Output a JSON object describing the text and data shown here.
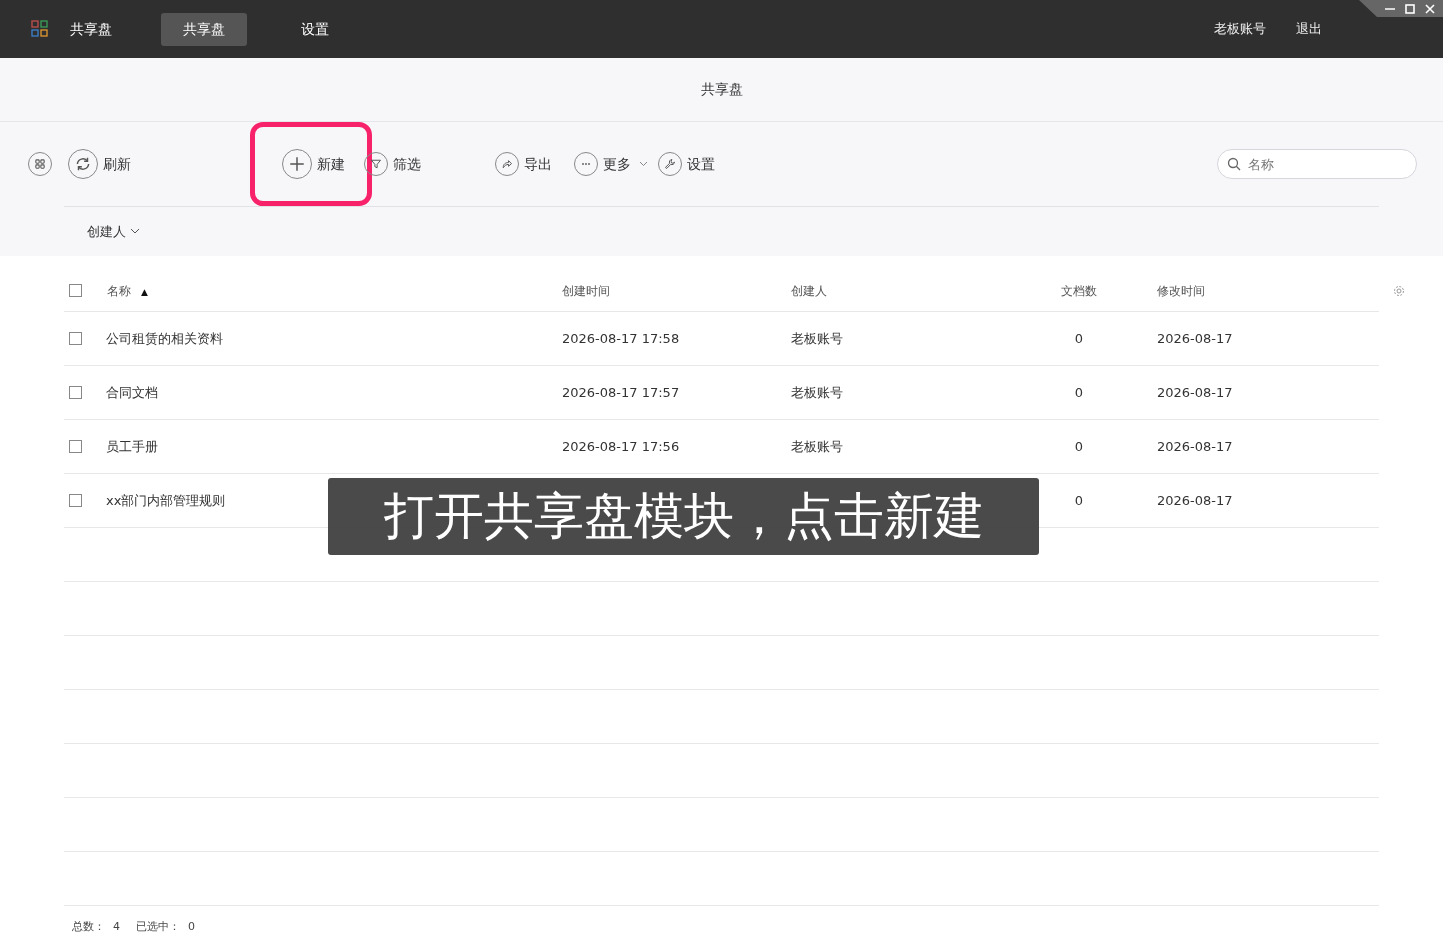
{
  "app": {
    "name": "共享盘"
  },
  "nav_tabs": [
    {
      "label": "共享盘",
      "selected": true
    },
    {
      "label": "设置",
      "selected": false
    }
  ],
  "user_menu": [
    "老板账号",
    "退出"
  ],
  "page_title": "共享盘",
  "toolbar": [
    {
      "kind": "refresh",
      "label": "刷新",
      "highlighted": false
    },
    {
      "kind": "new",
      "label": "新建",
      "highlighted": true
    },
    {
      "kind": "filter",
      "label": "筛选",
      "highlighted": false
    },
    {
      "kind": "export",
      "label": "导出",
      "highlighted": false
    },
    {
      "kind": "more",
      "label": "更多",
      "highlighted": false
    },
    {
      "kind": "settings",
      "label": "设置",
      "highlighted": false
    }
  ],
  "search": {
    "placeholder": "名称"
  },
  "filters": [
    {
      "label": "创建人"
    }
  ],
  "table": {
    "select_all": {
      "checked": false
    },
    "columns": [
      {
        "label": "名称",
        "sort_icon": "▲"
      },
      {
        "label": "创建时间"
      },
      {
        "label": "创建人"
      },
      {
        "label": "文档数"
      },
      {
        "label": "修改时间"
      }
    ],
    "rows": [
      {
        "checked": false,
        "name": "公司租赁的相关资料",
        "created": "2026-08-17 17:58",
        "creator": "老板账号",
        "docs": "0",
        "modified": "2026-08-17"
      },
      {
        "checked": false,
        "name": "合同文档",
        "created": "2026-08-17 17:57",
        "creator": "老板账号",
        "docs": "0",
        "modified": "2026-08-17"
      },
      {
        "checked": false,
        "name": "员工手册",
        "created": "2026-08-17 17:56",
        "creator": "老板账号",
        "docs": "0",
        "modified": "2026-08-17"
      },
      {
        "checked": false,
        "name": "xx部门内部管理规则",
        "docs": "0",
        "modified": "2026-08-17"
      }
    ]
  },
  "footer": {
    "total_label": "总数：",
    "total": "4",
    "selected_label": "已选中：",
    "selected": "0"
  },
  "caption": "打开共享盘模块，点击新建"
}
